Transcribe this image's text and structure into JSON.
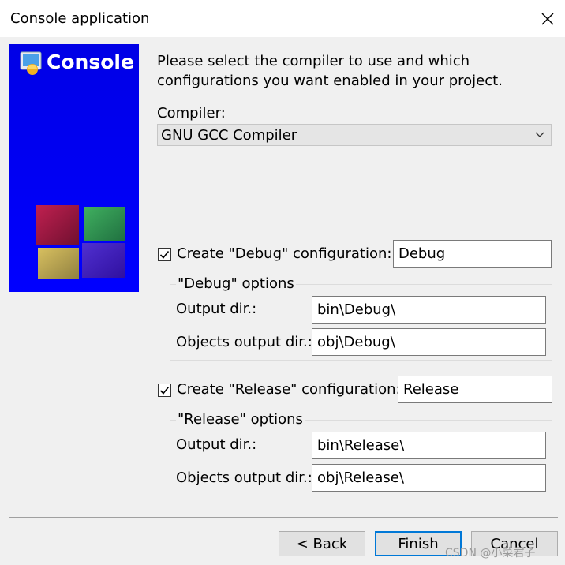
{
  "window": {
    "title": "Console application"
  },
  "side_panel": {
    "title": "Console"
  },
  "description": "Please select the compiler to use and which configurations you want enabled in your project.",
  "compiler": {
    "label": "Compiler:",
    "value": "GNU GCC Compiler"
  },
  "debug": {
    "checkbox_label": "Create \"Debug\" configuration:",
    "checked": true,
    "name_value": "Debug",
    "group_title": "\"Debug\" options",
    "output_dir_label": "Output dir.:",
    "output_dir_value": "bin\\Debug\\",
    "obj_dir_label": "Objects output dir.:",
    "obj_dir_value": "obj\\Debug\\"
  },
  "release": {
    "checkbox_label": "Create \"Release\" configuration:",
    "checked": true,
    "name_value": "Release",
    "group_title": "\"Release\" options",
    "output_dir_label": "Output dir.:",
    "output_dir_value": "bin\\Release\\",
    "obj_dir_label": "Objects output dir.:",
    "obj_dir_value": "obj\\Release\\"
  },
  "buttons": {
    "back": "< Back",
    "finish": "Finish",
    "cancel": "Cancel"
  },
  "watermark": "CSDN @小菜君子",
  "colors": {
    "panel_blue": "#0000ff",
    "accent": "#0078d7"
  }
}
